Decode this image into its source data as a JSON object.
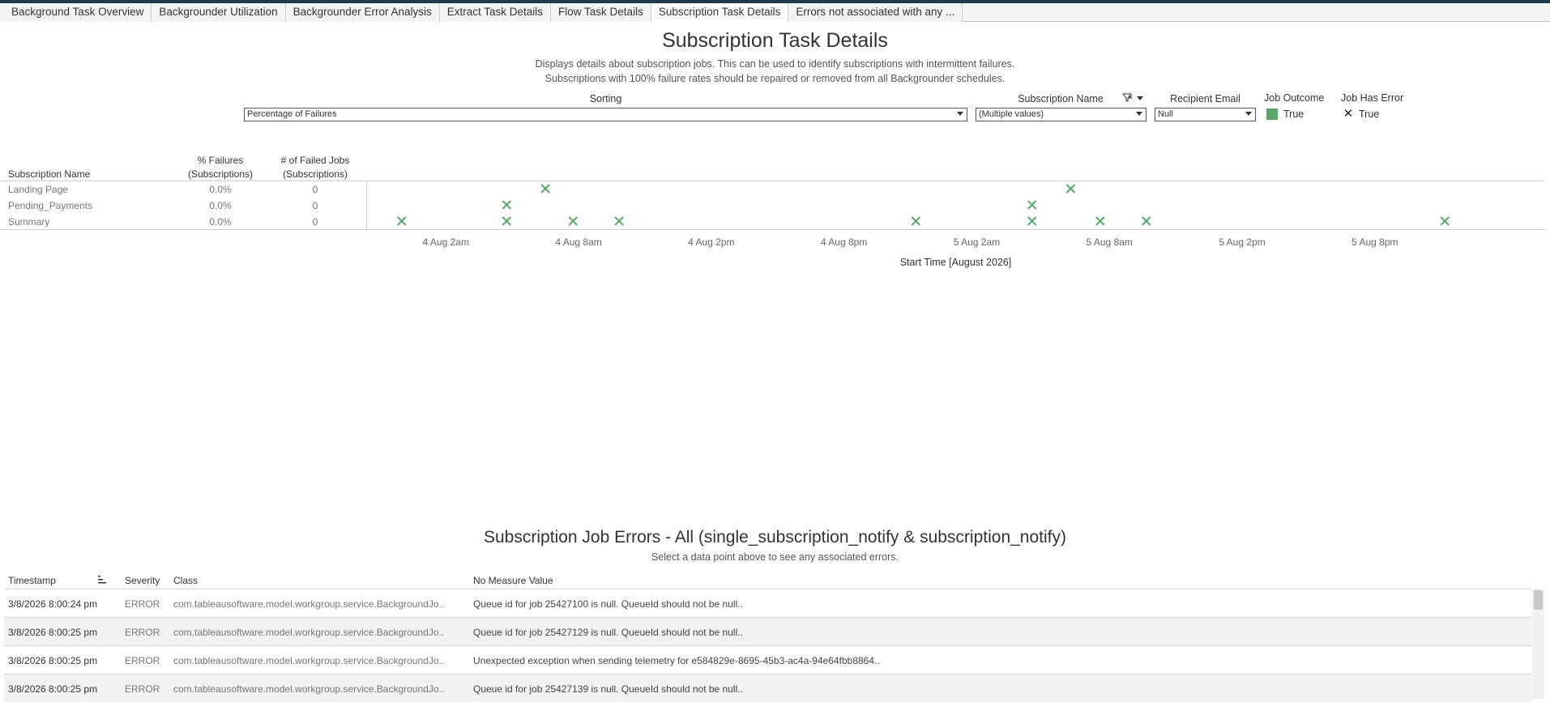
{
  "tabs": [
    "Background Task Overview",
    "Backgrounder Utilization",
    "Backgrounder Error Analysis",
    "Extract Task Details",
    "Flow Task Details",
    "Subscription Task Details",
    "Errors not associated with any ..."
  ],
  "active_tab": 5,
  "header": {
    "title": "Subscription Task Details",
    "desc_line1": "Displays details about subscription jobs.  This can be used to identify subscriptions with intermittent failures.",
    "desc_line2": "Subscriptions with 100% failure rates should be repaired or removed from all Backgrounder schedules."
  },
  "filters": {
    "sorting": {
      "label": "Sorting",
      "value": "Percentage of Failures"
    },
    "subscription_name": {
      "label": "Subscription Name",
      "value": "(Multiple values)"
    },
    "recipient_email": {
      "label": "Recipient Email",
      "value": "Null"
    },
    "job_outcome": {
      "label": "Job Outcome",
      "item": "True"
    },
    "job_has_error": {
      "label": "Job Has Error",
      "item": "True"
    }
  },
  "colors": {
    "mark_green": "#59a869",
    "accent": "#1f3a4a"
  },
  "grid": {
    "col_name": "Subscription Name",
    "col_pct_line1": "% Failures",
    "col_pct_line2": "(Subscriptions)",
    "col_cnt_line1": "# of Failed Jobs",
    "col_cnt_line2": "(Subscriptions)",
    "rows": [
      {
        "name": "Landing Page",
        "pct": "0.0%",
        "count": "0"
      },
      {
        "name": "Pending_Payments",
        "pct": "0.0%",
        "count": "0"
      },
      {
        "name": "Summary",
        "pct": "0.0%",
        "count": "0"
      }
    ]
  },
  "chart_data": {
    "type": "scatter",
    "xlabel": "Start Time [August 2026]",
    "x_ticks": [
      "4 Aug 2am",
      "4 Aug 8am",
      "4 Aug 2pm",
      "4 Aug 8pm",
      "5 Aug 2am",
      "5 Aug 8am",
      "5 Aug 2pm",
      "5 Aug 8pm"
    ],
    "x_range_hours_from_4aug_0am": [
      -1.6,
      51.7
    ],
    "categories": [
      "Landing Page",
      "Pending_Payments",
      "Summary"
    ],
    "marker": "x",
    "points": [
      {
        "row": "Landing Page",
        "t": "4 Aug 6:30am"
      },
      {
        "row": "Landing Page",
        "t": "5 Aug 6:15am"
      },
      {
        "row": "Pending_Payments",
        "t": "4 Aug 4:45am"
      },
      {
        "row": "Pending_Payments",
        "t": "5 Aug 4:30am"
      },
      {
        "row": "Summary",
        "t": "4 Aug 12:00am"
      },
      {
        "row": "Summary",
        "t": "4 Aug 4:45am"
      },
      {
        "row": "Summary",
        "t": "4 Aug 7:45am"
      },
      {
        "row": "Summary",
        "t": "4 Aug 9:50am"
      },
      {
        "row": "Summary",
        "t": "4 Aug 11:15pm"
      },
      {
        "row": "Summary",
        "t": "5 Aug 4:30am"
      },
      {
        "row": "Summary",
        "t": "5 Aug 7:35am"
      },
      {
        "row": "Summary",
        "t": "5 Aug 9:40am"
      },
      {
        "row": "Summary",
        "t": "5 Aug 11:10pm"
      }
    ]
  },
  "errors": {
    "title": "Subscription Job Errors - All (single_subscription_notify & subscription_notify)",
    "subtitle": "Select a data point above to see any associated errors.",
    "columns": {
      "timestamp": "Timestamp",
      "severity": "Severity",
      "class": "Class",
      "value": "No Measure Value"
    },
    "rows": [
      {
        "ts": "3/8/2026 8:00:24 pm",
        "sev": "ERROR",
        "cls": "com.tableausoftware.model.workgroup.service.BackgroundJo..",
        "msg": "Queue id for job 25427100 is null. QueueId should not be null.."
      },
      {
        "ts": "3/8/2026 8:00:25 pm",
        "sev": "ERROR",
        "cls": "com.tableausoftware.model.workgroup.service.BackgroundJo..",
        "msg": "Queue id for job 25427129 is null. QueueId should not be null.."
      },
      {
        "ts": "3/8/2026 8:00:25 pm",
        "sev": "ERROR",
        "cls": "com.tableausoftware.model.workgroup.service.BackgroundJo..",
        "msg": "Unexpected exception when sending telemetry for e584829e-8695-45b3-ac4a-94e64fbb8864.."
      },
      {
        "ts": "3/8/2026 8:00:25 pm",
        "sev": "ERROR",
        "cls": "com.tableausoftware.model.workgroup.service.BackgroundJo..",
        "msg": "Queue id for job 25427139 is null. QueueId should not be null.."
      }
    ]
  }
}
